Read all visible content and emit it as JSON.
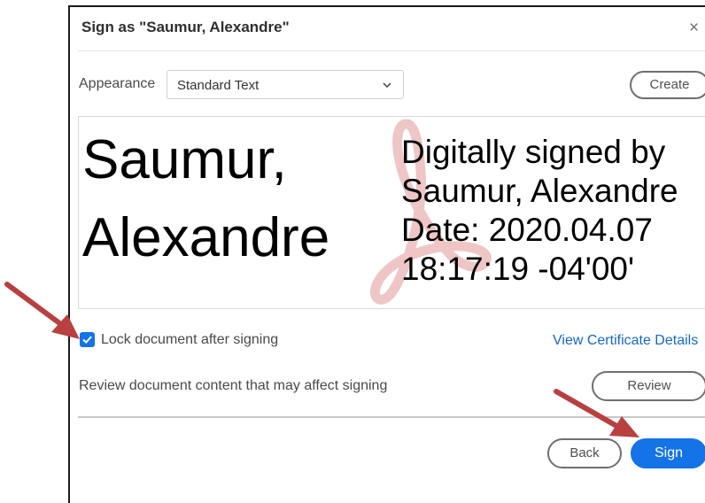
{
  "dialog": {
    "title": "Sign as \"Saumur, Alexandre\"",
    "close_glyph": "×",
    "close_icon": "close-icon"
  },
  "appearance": {
    "label": "Appearance",
    "selected": "Standard Text",
    "create_label": "Create"
  },
  "preview": {
    "name_line1": "Saumur,",
    "name_line2": "Alexandre",
    "details": [
      "Digitally signed by",
      "Saumur, Alexandre",
      "Date: 2020.04.07",
      "18:17:19 -04'00'"
    ],
    "watermark_icon": "adobe-pdf-logo"
  },
  "options": {
    "lock_label": "Lock document after signing",
    "lock_checked": true,
    "cert_link": "View Certificate Details",
    "review_text": "Review document content that may affect signing",
    "review_label": "Review"
  },
  "footer": {
    "back_label": "Back",
    "sign_label": "Sign"
  },
  "colors": {
    "accent": "#1473e6",
    "link": "#1668c2",
    "arrow": "#b84040",
    "watermark": "#e6a8a8"
  }
}
